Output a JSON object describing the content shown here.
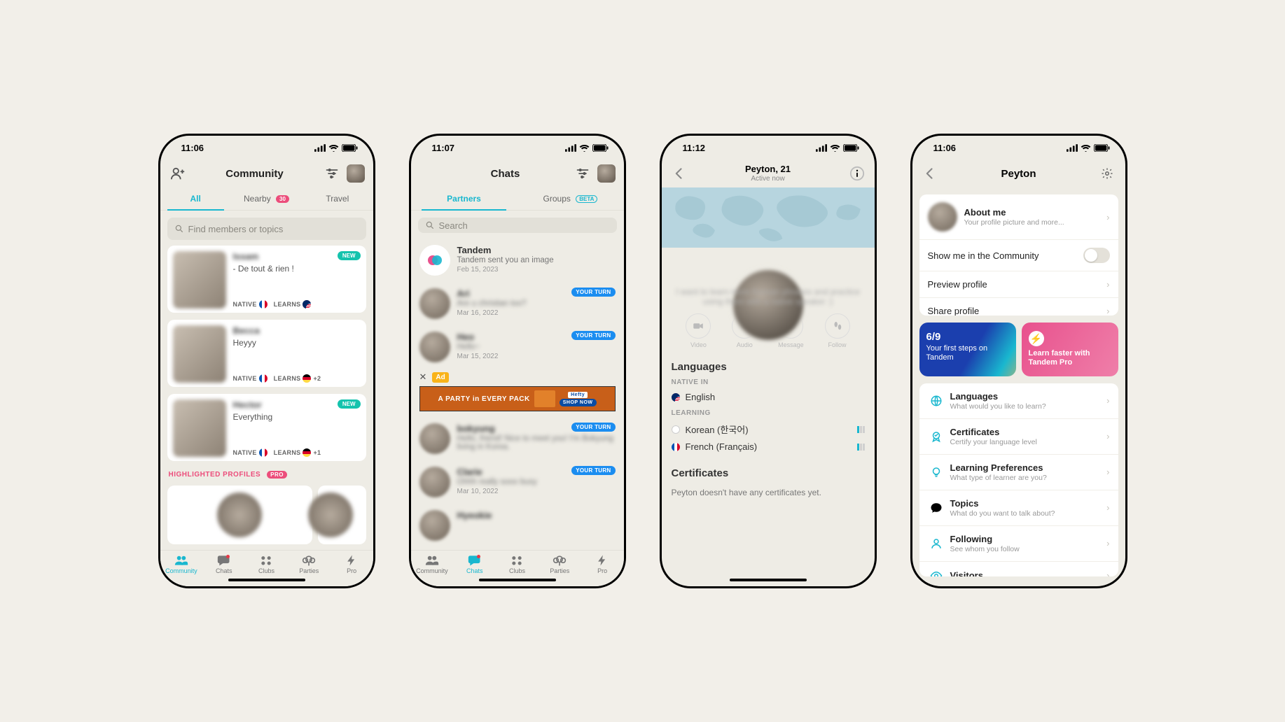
{
  "screens": {
    "community": {
      "time": "11:06",
      "title": "Community",
      "search_placeholder": "Find members or topics",
      "tabs": {
        "all": "All",
        "nearby": "Nearby",
        "nearby_badge": "30",
        "travel": "Travel"
      },
      "members": [
        {
          "name": "Issam",
          "line": "- De tout & rien !",
          "native_label": "NATIVE",
          "learns_label": "LEARNS",
          "learns_extra": "",
          "new": true,
          "native_flag": "fr",
          "learns_flag": "us"
        },
        {
          "name": "Becca",
          "line": "Heyyy",
          "native_label": "NATIVE",
          "learns_label": "LEARNS",
          "learns_extra": "+2",
          "new": false,
          "native_flag": "fr",
          "learns_flag": "de"
        },
        {
          "name": "Hector",
          "line": "Everything",
          "native_label": "NATIVE",
          "learns_label": "LEARNS",
          "learns_extra": "+1",
          "new": true,
          "native_flag": "fr",
          "learns_flag": "de"
        }
      ],
      "highlighted_label": "HIGHLIGHTED PROFILES",
      "highlighted_badge": "PRO",
      "tabbar": [
        "Community",
        "Chats",
        "Clubs",
        "Parties",
        "Pro"
      ]
    },
    "chats": {
      "time": "11:07",
      "title": "Chats",
      "tabs": {
        "partners": "Partners",
        "groups": "Groups",
        "groups_badge": "BETA"
      },
      "search_placeholder": "Search",
      "turn_label": "YOUR TURN",
      "ad_label": "Ad",
      "ad_text": "A PARTY in EVERY PACK",
      "ad_cta": "SHOP NOW",
      "rows": [
        {
          "name": "Tandem",
          "sub": "Tandem sent you an image",
          "date": "Feb 15, 2023",
          "turn": false,
          "tandem": true
        },
        {
          "name": "Ari",
          "sub": "Are u christian too?",
          "date": "Mar 16, 2022",
          "turn": true
        },
        {
          "name": "Heo",
          "sub": "Hello~",
          "date": "Mar 15, 2022",
          "turn": true
        },
        {
          "name": "bokyung",
          "sub": "Hello, friend! Nice to meet you! I'm Bokyung living in Korea.",
          "date": "",
          "turn": true
        },
        {
          "name": "Clarie",
          "sub": "Ohhh really sooo busy",
          "date": "Mar 10, 2022",
          "turn": true
        },
        {
          "name": "Hyeokie",
          "sub": "",
          "date": "",
          "turn": false
        }
      ],
      "tabbar": [
        "Community",
        "Chats",
        "Clubs",
        "Parties",
        "Pro"
      ]
    },
    "profile": {
      "time": "11:12",
      "name_age": "Peyton, 21",
      "status": "Active now",
      "bio": "I want to learn more Korean phrases and practice using them with a native speaker :)",
      "actions": {
        "video": "Video",
        "audio": "Audio",
        "message": "Message",
        "follow": "Follow"
      },
      "languages_title": "Languages",
      "native_label": "NATIVE IN",
      "native_lang": "English",
      "learning_label": "LEARNING",
      "learning": [
        {
          "lang": "Korean (한국어)",
          "flag": "kr"
        },
        {
          "lang": "French (Français)",
          "flag": "fr"
        }
      ],
      "certificates_title": "Certificates",
      "certificates_empty": "Peyton doesn't have any certificates yet."
    },
    "settings": {
      "time": "11:06",
      "title": "Peyton",
      "about_title": "About me",
      "about_sub": "Your profile picture and more...",
      "show_label": "Show me in the Community",
      "preview_label": "Preview profile",
      "share_label": "Share profile",
      "promos": {
        "steps_count": "6/9",
        "steps_text": "Your first steps on Tandem",
        "pro_text": "Learn faster with Tandem Pro"
      },
      "menu": [
        {
          "title": "Languages",
          "sub": "What would you like to learn?",
          "icon": "globe"
        },
        {
          "title": "Certificates",
          "sub": "Certify your language level",
          "icon": "badge"
        },
        {
          "title": "Learning Preferences",
          "sub": "What type of learner are you?",
          "icon": "bulb"
        },
        {
          "title": "Topics",
          "sub": "What do you want to talk about?",
          "icon": "chat"
        },
        {
          "title": "Following",
          "sub": "See whom you follow",
          "icon": "user"
        },
        {
          "title": "Visitors",
          "sub": "",
          "icon": "eye"
        }
      ]
    }
  }
}
